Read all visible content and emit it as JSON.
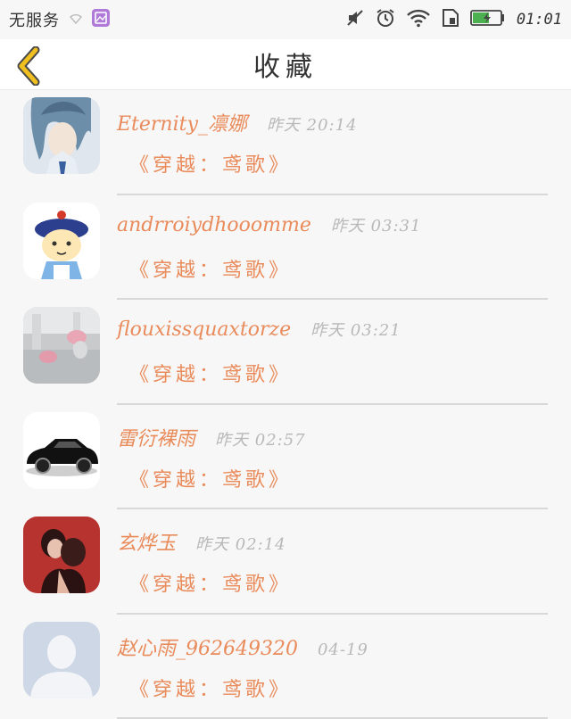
{
  "status_bar": {
    "carrier": "无服务",
    "time": "01:01",
    "icons": [
      "signal-icon",
      "gallery-icon",
      "mute-icon",
      "alarm-icon",
      "wifi-icon",
      "sim-icon",
      "battery-charging-icon"
    ],
    "battery_color": "#4caf50"
  },
  "header": {
    "title": "收藏",
    "back_icon": "chevron-left-icon",
    "back_color": "#f0c020"
  },
  "favorites": [
    {
      "name": "Eternity_凛娜",
      "time": "昨天 20:14",
      "book": "《穿越：鸢歌》",
      "avatar": "anime-boy-avatar"
    },
    {
      "name": "andrroiydhooomme",
      "time": "昨天 03:31",
      "book": "《穿越：鸢歌》",
      "avatar": "cartoon-qing-official-avatar"
    },
    {
      "name": "flouxissquaxtorze",
      "time": "昨天 03:21",
      "book": "《穿越：鸢歌》",
      "avatar": "pink-toy-avatar"
    },
    {
      "name": "雷衍裸雨",
      "time": "昨天 02:57",
      "book": "《穿越：鸢歌》",
      "avatar": "black-car-avatar"
    },
    {
      "name": "玄烨玉",
      "time": "昨天 02:14",
      "book": "《穿越：鸢歌》",
      "avatar": "couple-photo-avatar"
    },
    {
      "name": "赵心雨_962649320",
      "time": "04-19",
      "book": "《穿越：鸢歌》",
      "avatar": "default-person-avatar"
    }
  ],
  "colors": {
    "accent": "#e98b5b",
    "muted": "#b8b8b8",
    "background": "#f7f7f7"
  }
}
